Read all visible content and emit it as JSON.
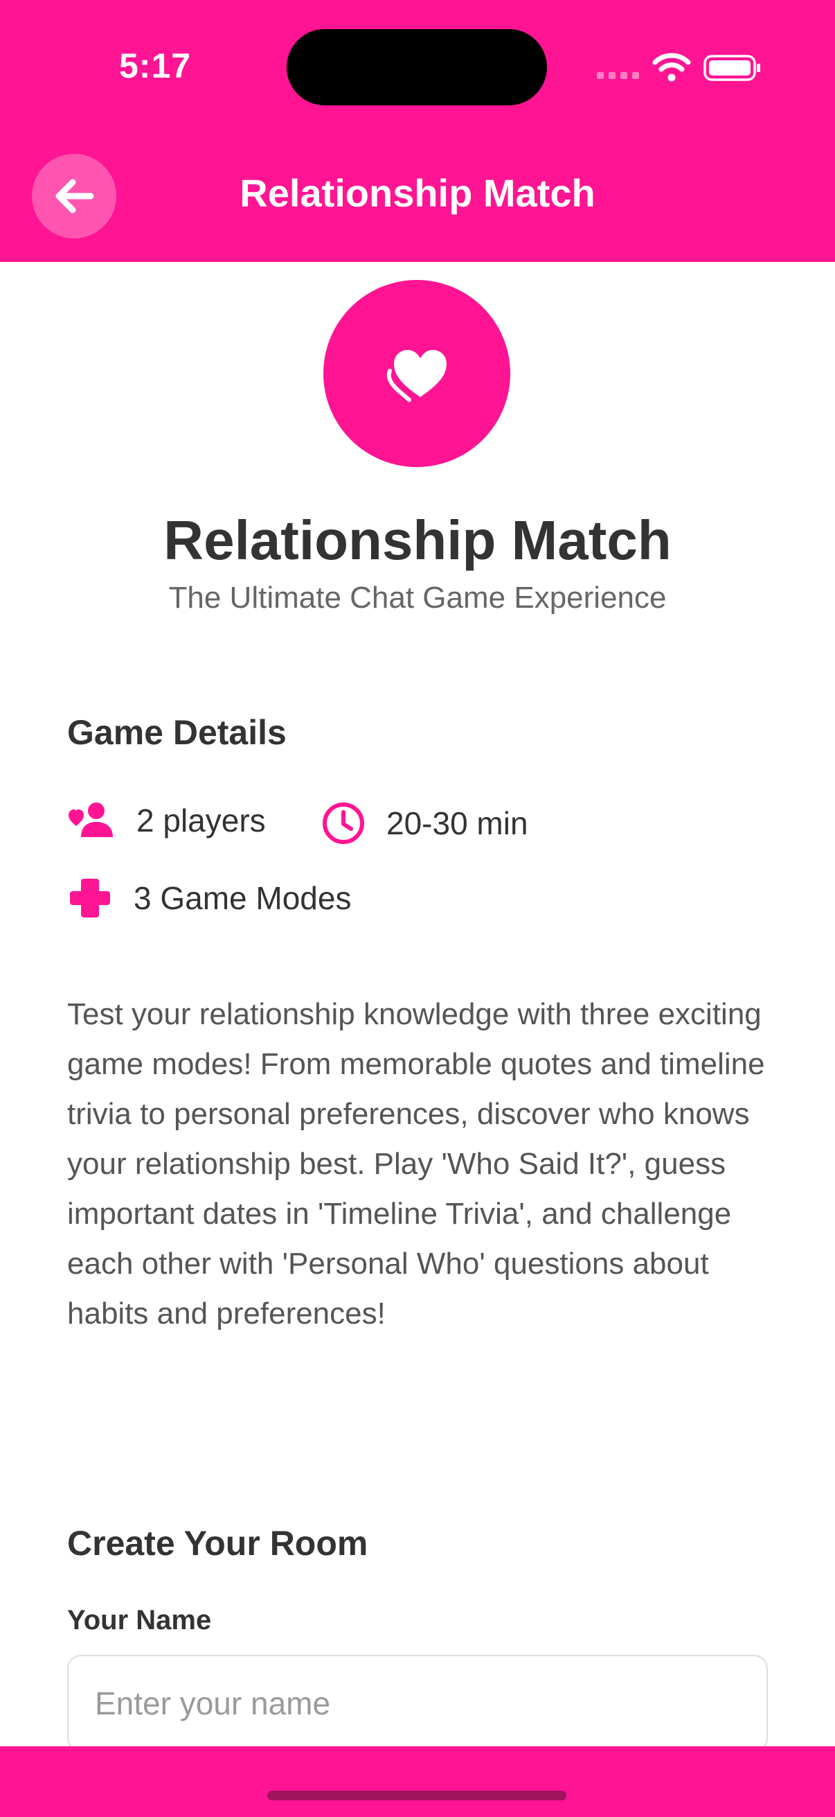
{
  "colors": {
    "accent": "#FF1493",
    "text_dark": "#333333",
    "text_muted": "#666666"
  },
  "status_bar": {
    "time": "5:17",
    "icons": [
      "signal-icon",
      "wifi-icon",
      "battery-icon"
    ]
  },
  "header": {
    "title": "Relationship Match",
    "back_icon": "arrow-left-icon"
  },
  "hero": {
    "icon": "heart-icon",
    "title": "Relationship Match",
    "subtitle": "The Ultimate Chat Game Experience"
  },
  "details": {
    "heading": "Game Details",
    "players": {
      "icon": "user-heart-icon",
      "label": "2 players"
    },
    "duration": {
      "icon": "clock-icon",
      "label": "20-30 min"
    },
    "modes": {
      "icon": "plus-icon",
      "label": "3 Game Modes"
    }
  },
  "description": "Test your relationship knowledge with three exciting game modes! From memorable quotes and timeline trivia to personal preferences, discover who knows your relationship best. Play 'Who Said It?', guess important dates in 'Timeline Trivia', and challenge each other with 'Personal Who' questions about habits and preferences!",
  "create_room": {
    "heading": "Create Your Room",
    "name_label": "Your Name",
    "name_value": "",
    "name_placeholder": "Enter your name"
  }
}
